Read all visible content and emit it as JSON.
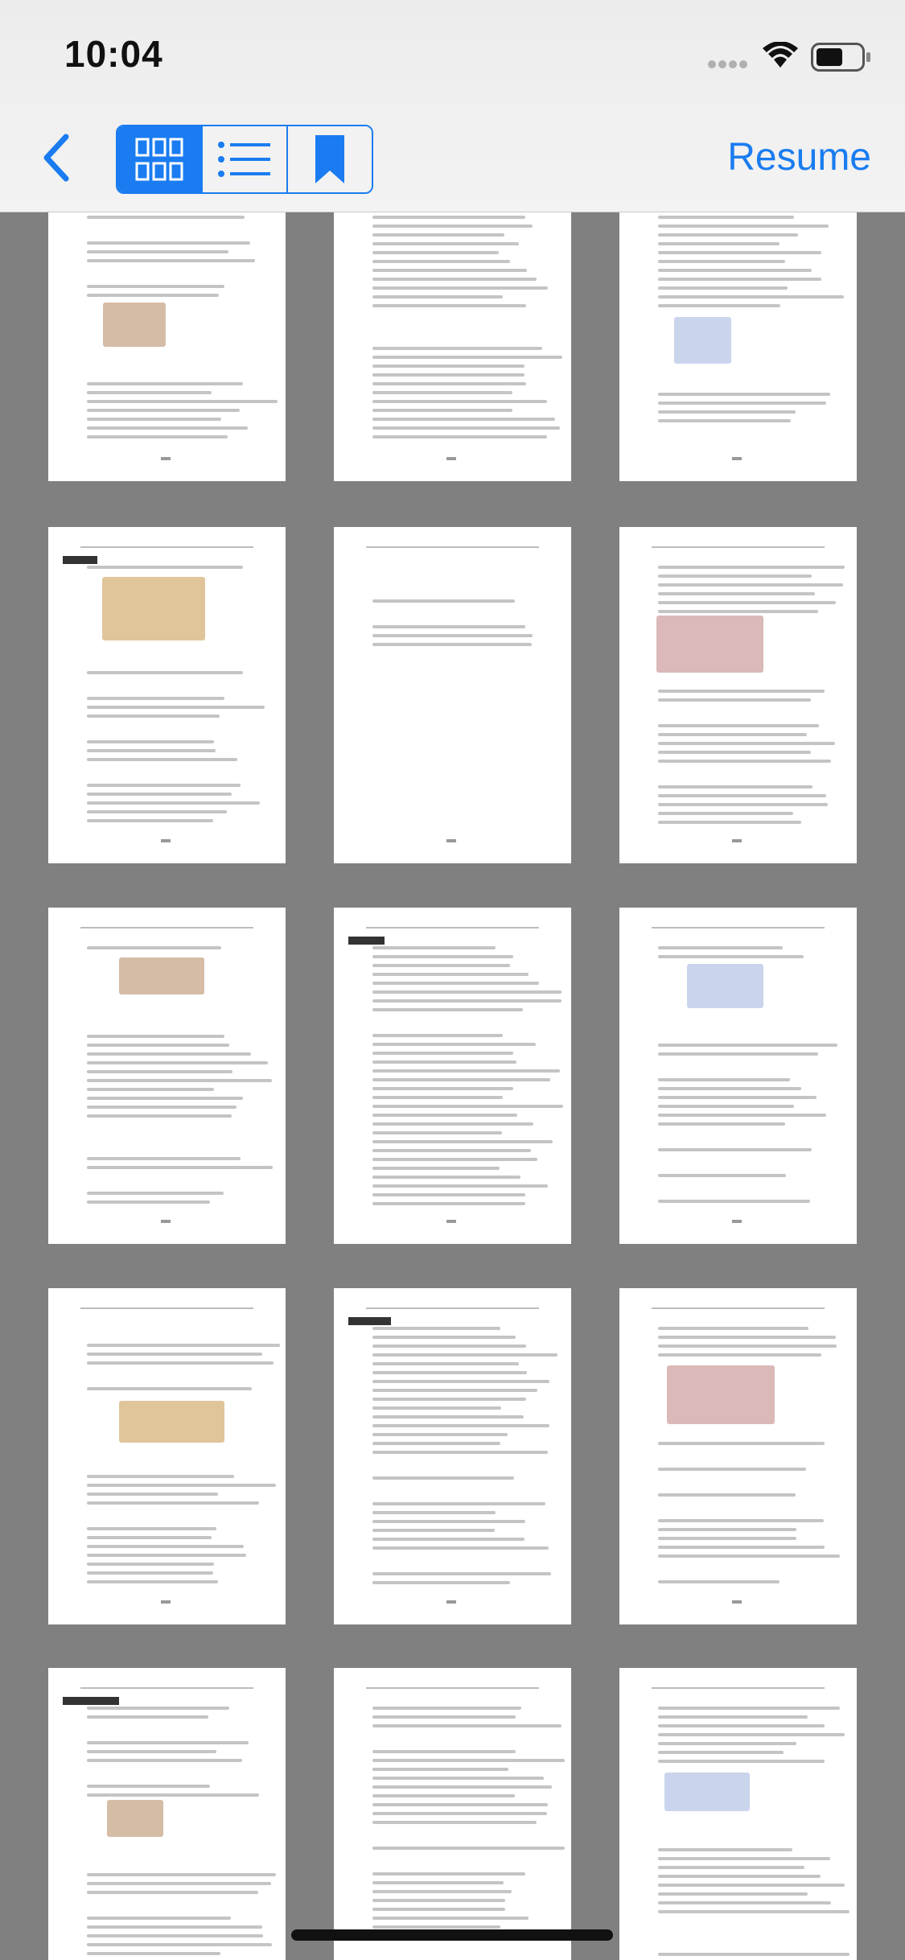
{
  "status": {
    "time": "10:04"
  },
  "nav": {
    "back_label": "",
    "segments": [
      {
        "name": "grid",
        "icon": "grid-icon",
        "active": true
      },
      {
        "name": "list",
        "icon": "list-icon",
        "active": false
      },
      {
        "name": "bookmark",
        "icon": "bookmark-icon",
        "active": false
      }
    ],
    "resume_label": "Resume"
  },
  "colors": {
    "accent": "#1a7cf0",
    "background": "#808080"
  },
  "thumbnails": [
    {
      "row": 1,
      "col": 1
    },
    {
      "row": 1,
      "col": 2
    },
    {
      "row": 1,
      "col": 3
    },
    {
      "row": 2,
      "col": 1
    },
    {
      "row": 2,
      "col": 2
    },
    {
      "row": 2,
      "col": 3
    },
    {
      "row": 3,
      "col": 1
    },
    {
      "row": 3,
      "col": 2
    },
    {
      "row": 3,
      "col": 3
    },
    {
      "row": 4,
      "col": 1
    },
    {
      "row": 4,
      "col": 2
    },
    {
      "row": 4,
      "col": 3
    },
    {
      "row": 5,
      "col": 1
    },
    {
      "row": 5,
      "col": 2
    },
    {
      "row": 5,
      "col": 3
    }
  ]
}
